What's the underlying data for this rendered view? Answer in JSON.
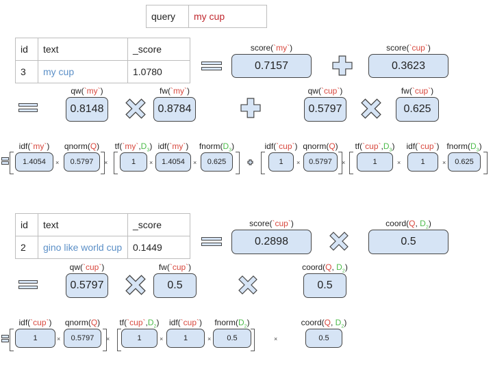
{
  "query_table": {
    "label": "query",
    "value": "my cup"
  },
  "doc1": {
    "headers": [
      "id",
      "text",
      "_score"
    ],
    "id": "3",
    "text": "my cup",
    "score": "1.0780",
    "score_terms": [
      {
        "label_pre": "score(",
        "term": "`my`",
        "label_post": ")",
        "value": "0.7157"
      },
      {
        "label_pre": "score(",
        "term": "`cup`",
        "label_post": ")",
        "value": "0.3623"
      }
    ],
    "weights": {
      "qw_my": {
        "label_pre": "qw(",
        "term": "`my`",
        "label_post": ")",
        "value": "0.8148"
      },
      "fw_my": {
        "label_pre": "fw(",
        "term": "`my`",
        "label_post": ")",
        "value": "0.8784"
      },
      "qw_cup": {
        "label_pre": "qw(",
        "term": "`cup`",
        "label_post": ")",
        "value": "0.5797"
      },
      "fw_cup": {
        "label_pre": "fw(",
        "term": "`cup`",
        "label_post": ")",
        "value": "0.625"
      }
    },
    "factors": {
      "idf_my_q": {
        "label_pre": "idf(",
        "term": "`my`",
        "label_post": ")",
        "value": "1.4054"
      },
      "qnorm_my": {
        "label_pre": "qnorm(",
        "q": "Q",
        "label_post": ")",
        "value": "0.5797"
      },
      "tf_my": {
        "label_pre": "tf(",
        "term": "`my`",
        "comma": ",",
        "doc": "D",
        "doc_sub": "3",
        "label_post": ")",
        "value": "1"
      },
      "idf_my_f": {
        "label_pre": "idf(",
        "term": "`my`",
        "label_post": ")",
        "value": "1.4054"
      },
      "fnorm_my": {
        "label_pre": "fnorm(",
        "doc": "D",
        "doc_sub": "3",
        "label_post": ")",
        "value": "0.625"
      },
      "idf_cup_q": {
        "label_pre": "idf(",
        "term": "`cup`",
        "label_post": ")",
        "value": "1"
      },
      "qnorm_cup": {
        "label_pre": "qnorm(",
        "q": "Q",
        "label_post": ")",
        "value": "0.5797"
      },
      "tf_cup": {
        "label_pre": "tf(",
        "term": "`cup`",
        "comma": ",",
        "doc": "D",
        "doc_sub": "3",
        "label_post": ")",
        "value": "1"
      },
      "idf_cup_f": {
        "label_pre": "idf(",
        "term": "`cup`",
        "label_post": ")",
        "value": "1"
      },
      "fnorm_cup": {
        "label_pre": "fnorm(",
        "doc": "D",
        "doc_sub": "3",
        "label_post": ")",
        "value": "0.625"
      }
    }
  },
  "doc2": {
    "headers": [
      "id",
      "text",
      "_score"
    ],
    "id": "2",
    "text": "gino like world cup",
    "score": "0.1449",
    "score_cup": {
      "label_pre": "score(",
      "term": "`cup`",
      "label_post": ")",
      "value": "0.2898"
    },
    "coord": {
      "label_pre": "coord(",
      "q": "Q",
      "sep": ", ",
      "doc": "D",
      "doc_sub": "2",
      "label_post": ")",
      "value": "0.5"
    },
    "qw_cup": {
      "label_pre": "qw(",
      "term": "`cup`",
      "label_post": ")",
      "value": "0.5797"
    },
    "fw_cup": {
      "label_pre": "fw(",
      "term": "`cup`",
      "label_post": ")",
      "value": "0.5"
    },
    "coord2": {
      "label_pre": "coord(",
      "q": "Q",
      "sep": ", ",
      "doc": "D",
      "doc_sub": "2",
      "label_post": ")",
      "value": "0.5"
    },
    "factors": {
      "idf_cup_q": {
        "label_pre": "idf(",
        "term": "`cup`",
        "label_post": ")",
        "value": "1"
      },
      "qnorm_cup": {
        "label_pre": "qnorm(",
        "q": "Q",
        "label_post": ")",
        "value": "0.5797"
      },
      "tf_cup": {
        "label_pre": "tf(",
        "term": "`cup`",
        "comma": ",",
        "doc": "D",
        "doc_sub": "2",
        "label_post": ")",
        "value": "1"
      },
      "idf_cup_f": {
        "label_pre": "idf(",
        "term": "`cup`",
        "label_post": ")",
        "value": "1"
      },
      "fnorm_cup": {
        "label_pre": "fnorm(",
        "doc": "D",
        "doc_sub": "2",
        "label_post": ")",
        "value": "0.5"
      },
      "coord3": {
        "label_pre": "coord(",
        "q": "Q",
        "sep": ", ",
        "doc": "D",
        "doc_sub": "2",
        "label_post": ")",
        "value": "0.5"
      }
    }
  },
  "colors": {
    "query_red": "#c0272d",
    "term_red": "#d8483e",
    "doc_green": "#4cbb4a",
    "doc_blue": "#5b8fc7",
    "box_fill": "#d6e4f5"
  },
  "operators": {
    "equals": "equals",
    "plus": "plus",
    "times": "times",
    "small_times": "×"
  }
}
